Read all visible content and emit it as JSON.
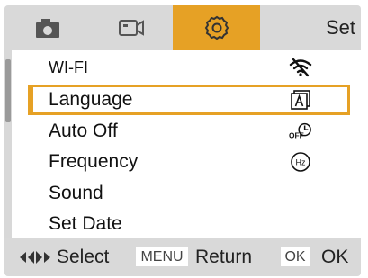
{
  "tabs": [
    {
      "icon": "camera-icon"
    },
    {
      "icon": "video-icon"
    },
    {
      "icon": "settings-gear-icon",
      "active": true
    }
  ],
  "header": {
    "title": "Set"
  },
  "menu": {
    "items": [
      {
        "label": "WI-FI",
        "icon": "wifi-off-icon"
      },
      {
        "label": "Language",
        "icon": "language-icon",
        "selected": true
      },
      {
        "label": "Auto Off",
        "icon": "auto-off-icon"
      },
      {
        "label": "Frequency",
        "icon": "frequency-hz-icon"
      },
      {
        "label": "Sound"
      },
      {
        "label": "Set Date"
      }
    ]
  },
  "footer": {
    "select_label": "Select",
    "menu_key": "MENU",
    "return_label": "Return",
    "ok_key": "OK",
    "ok_label": "OK"
  },
  "colors": {
    "accent": "#e6a125",
    "bar_bg": "#d9d9d9",
    "list_bg": "#ffffff"
  }
}
